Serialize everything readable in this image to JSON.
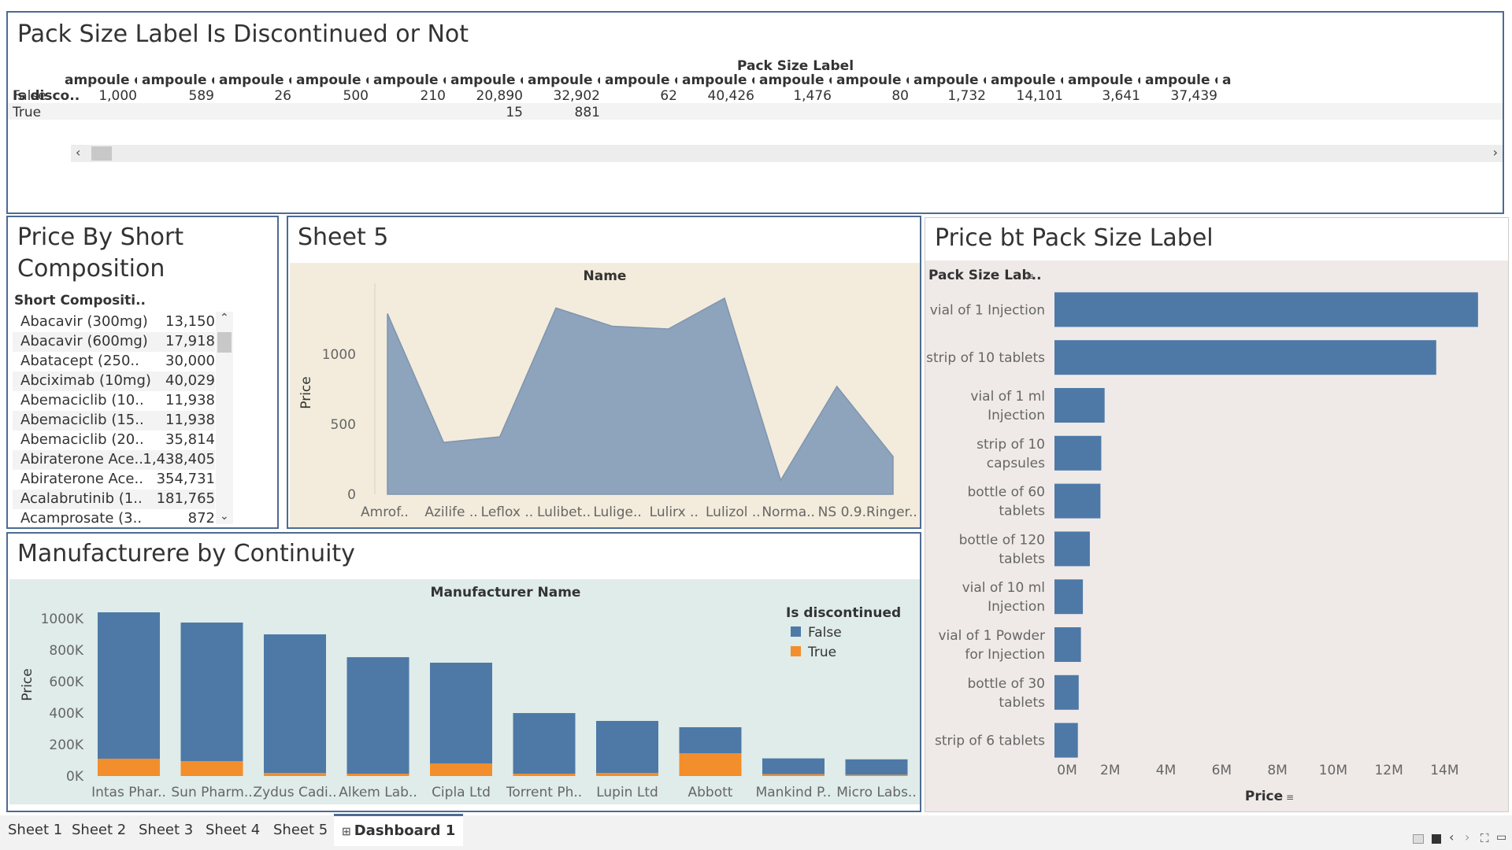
{
  "crosstab": {
    "title": "Pack Size Label Is Discontinued or Not",
    "column_group_label": "Pack Size Label",
    "row_header": "Is disco..",
    "columns": [
      "ampoule of ..",
      "ampoule of ..",
      "ampoule of ..",
      "ampoule of ..",
      "ampoule of ..",
      "ampoule of ..",
      "ampoule of ..",
      "ampoule of ..",
      "ampoule of ..",
      "ampoule of ..",
      "ampoule of ..",
      "ampoule of ..",
      "ampoule of ..",
      "ampoule of ..",
      "ampoule of ..",
      "a"
    ],
    "rows": [
      {
        "label": "False",
        "values": [
          "1,000",
          "589",
          "26",
          "500",
          "210",
          "20,890",
          "32,902",
          "62",
          "40,426",
          "1,476",
          "80",
          "1,732",
          "14,101",
          "3,641",
          "37,439",
          ""
        ]
      },
      {
        "label": "True",
        "values": [
          "",
          "",
          "",
          "",
          "",
          "15",
          "881",
          "",
          "",
          "",
          "",
          "",
          "",
          "",
          "",
          ""
        ]
      }
    ],
    "scroll_left_icon": "chevron-left-icon",
    "scroll_right_icon": "chevron-right-icon"
  },
  "short_comp": {
    "title_line1": "Price By Short",
    "title_line2": "Composition",
    "header": "Short Compositi..",
    "rows": [
      {
        "name": "Abacavir (300mg)",
        "value": "13,150"
      },
      {
        "name": "Abacavir (600mg)",
        "value": "17,918"
      },
      {
        "name": "Abatacept (250..",
        "value": "30,000"
      },
      {
        "name": "Abciximab (10mg)",
        "value": "40,029"
      },
      {
        "name": "Abemaciclib (10..",
        "value": "11,938"
      },
      {
        "name": "Abemaciclib (15..",
        "value": "11,938"
      },
      {
        "name": "Abemaciclib (20..",
        "value": "35,814"
      },
      {
        "name": "Abiraterone Ace..",
        "value": "1,438,405"
      },
      {
        "name": "Abiraterone Ace..",
        "value": "354,731"
      },
      {
        "name": "Acalabrutinib (1..",
        "value": "181,765"
      },
      {
        "name": "Acamprosate (3..",
        "value": "872"
      }
    ],
    "scroll_up_icon": "chevron-up-icon",
    "scroll_down_icon": "chevron-down-icon"
  },
  "sheet5": {
    "title": "Sheet 5",
    "chart_data": {
      "type": "area",
      "title": "Name",
      "xlabel": "",
      "ylabel": "Price",
      "categories": [
        "Amrof..",
        "Azilife ..",
        "Leflox ..",
        "Lulibet..",
        "Lulige..",
        "Lulirx ..",
        "Lulizol ..",
        "Norma..",
        "NS 0.9..",
        "Ringer.."
      ],
      "values": [
        1290,
        370,
        410,
        1330,
        1200,
        1180,
        1400,
        100,
        770,
        270
      ],
      "ylim": [
        0,
        1450
      ],
      "yticks": [
        "0",
        "500",
        "1000"
      ],
      "ytick_values": [
        0,
        500,
        1000
      ],
      "grid": false,
      "colors": {
        "fill": "#8ea3bc",
        "stroke": "#7f95b0",
        "background": "#f3ecdc"
      }
    }
  },
  "manufacturer": {
    "title": "Manufacturere by Continuity",
    "chart_data": {
      "type": "bar",
      "title": "Manufacturer Name",
      "xlabel": "",
      "ylabel": "Price",
      "categories": [
        "Intas Phar..",
        "Sun Pharm..",
        "Zydus Cadi..",
        "Alkem Lab..",
        "Cipla Ltd",
        "Torrent Ph..",
        "Lupin Ltd",
        "Abbott",
        "Mankind P..",
        "Micro Labs.."
      ],
      "series": [
        {
          "name": "False",
          "color": "#4e79a7",
          "values": [
            930000,
            880000,
            880000,
            740000,
            640000,
            385000,
            330000,
            165000,
            100000,
            98000
          ]
        },
        {
          "name": "True",
          "color": "#f28e2b",
          "values": [
            110000,
            95000,
            20000,
            15000,
            80000,
            15000,
            20000,
            145000,
            12000,
            8000
          ]
        }
      ],
      "stacked": true,
      "ylim": [
        0,
        1100000
      ],
      "yticks": [
        "0K",
        "200K",
        "400K",
        "600K",
        "800K",
        "1000K"
      ],
      "ytick_values": [
        0,
        200000,
        400000,
        600000,
        800000,
        1000000
      ],
      "legend_title": "Is discontinued",
      "legend_position": "top-right",
      "grid": false,
      "background": "#dfece9"
    }
  },
  "packsize": {
    "title": "Price bt Pack Size Label",
    "chart_data": {
      "type": "bar",
      "orientation": "horizontal",
      "header": "Pack Size Lab..",
      "xlabel": "Price",
      "categories": [
        [
          "vial of 1 Injection"
        ],
        [
          "strip of 10 tablets"
        ],
        [
          "vial of 1 ml",
          "Injection"
        ],
        [
          "strip of 10",
          "capsules"
        ],
        [
          "bottle of 60",
          "tablets"
        ],
        [
          "bottle of 120",
          "tablets"
        ],
        [
          "vial of 10 ml",
          "Injection"
        ],
        [
          "vial of 1 Powder",
          "for Injection"
        ],
        [
          "bottle of 30",
          "tablets"
        ],
        [
          "strip of 6 tablets"
        ]
      ],
      "values": [
        15200000,
        13700000,
        1800000,
        1680000,
        1650000,
        1270000,
        1020000,
        950000,
        870000,
        840000
      ],
      "xlim": [
        0,
        15600000
      ],
      "xticks": [
        "0M",
        "2M",
        "4M",
        "6M",
        "8M",
        "10M",
        "12M",
        "14M"
      ],
      "xtick_values": [
        0,
        2000000,
        4000000,
        6000000,
        8000000,
        10000000,
        12000000,
        14000000
      ],
      "color": "#4e79a7",
      "background": "#efeae8"
    }
  },
  "tabs": [
    {
      "label": "Sheet 1",
      "active": false
    },
    {
      "label": "Sheet 2",
      "active": false
    },
    {
      "label": "Sheet 3",
      "active": false
    },
    {
      "label": "Sheet 4",
      "active": false
    },
    {
      "label": "Sheet 5",
      "active": false
    },
    {
      "label": "Dashboard 1",
      "active": true
    }
  ],
  "footer_icons": [
    "grid-view-icon",
    "single-view-icon",
    "prev-icon",
    "next-icon",
    "fullscreen-icon",
    "present-icon"
  ]
}
